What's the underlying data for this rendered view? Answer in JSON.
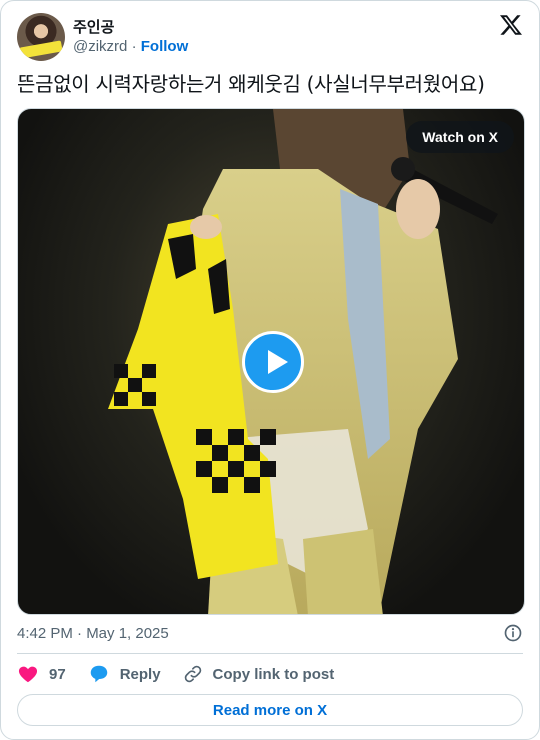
{
  "user": {
    "name": "주인공",
    "handle": "@zikzrd",
    "separator": "·",
    "follow_label": "Follow"
  },
  "tweet": {
    "text": "뜬금없이 시력자랑하는거 왜케웃김 (사실너무부러웠어요)"
  },
  "media": {
    "watch_label": "Watch on X",
    "type": "video"
  },
  "meta": {
    "timestamp": "4:42 PM · May 1, 2025"
  },
  "actions": {
    "likes": "97",
    "reply_label": "Reply",
    "copy_label": "Copy link to post"
  },
  "footer": {
    "read_more": "Read more on X"
  },
  "colors": {
    "accent": "#1d9bf0",
    "link": "#006fd6",
    "like": "#f91880",
    "muted": "#536471",
    "border": "#cfd9de"
  },
  "icons": [
    "x-logo-icon",
    "info-icon",
    "heart-icon",
    "reply-bubble-icon",
    "link-icon",
    "play-icon"
  ]
}
